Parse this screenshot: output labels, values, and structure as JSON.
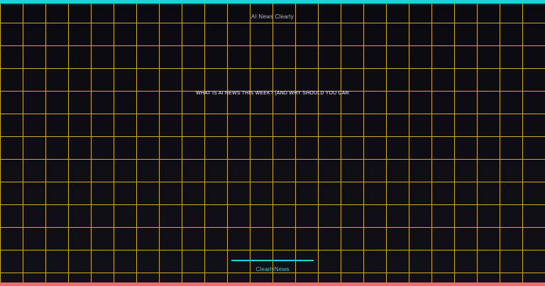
{
  "header": {
    "brand": "AI News Clearly"
  },
  "main": {
    "headline": "WHAT IS AI NEWS THIS WEEK? (AND WHY SHOULD YOU CAR"
  },
  "footer": {
    "brand": "ClearlyNews"
  },
  "colors": {
    "background": "#0d0c11",
    "grid": "#d8b424",
    "top_bar": "#16d6da",
    "bottom_bar": "#f06b6b",
    "accent": "#16d6da",
    "headline_text": "#ffffff",
    "brand_text": "#b8b8bf"
  }
}
